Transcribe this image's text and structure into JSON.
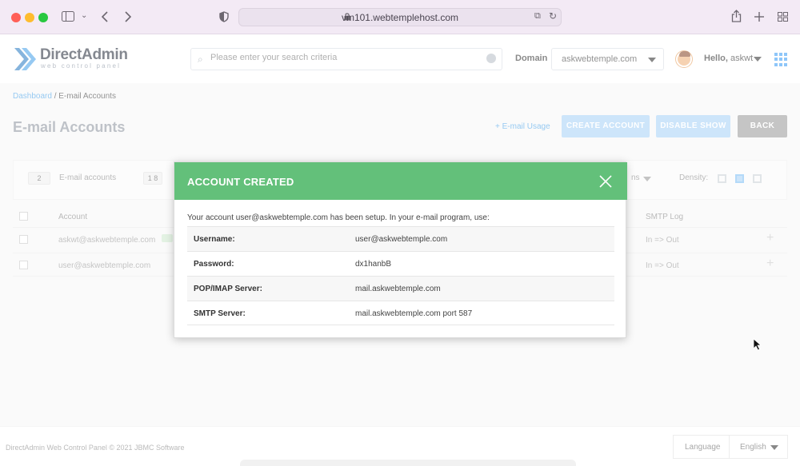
{
  "browser": {
    "url": "vm101.webtemplehost.com"
  },
  "header": {
    "logo_title": "DirectAdmin",
    "logo_subtitle": "web control panel",
    "search_placeholder": "Please enter your search criteria",
    "domain_label": "Domain",
    "domain_value": "askwebtemple.com",
    "hello_prefix": "Hello,",
    "username": "askwt"
  },
  "breadcrumb": {
    "home": "Dashboard",
    "separator": "/",
    "current": "E-mail Accounts"
  },
  "page": {
    "title": "E-mail Accounts",
    "usage_link": "+ E-mail Usage",
    "buttons": {
      "create": "CREATE ACCOUNT",
      "disable": "DISABLE SHOW",
      "back": "BACK"
    }
  },
  "summary": {
    "count_badge": "2",
    "count_label": "E-mail accounts",
    "second_badge": "1 8",
    "filter_label": "ns",
    "density_label": "Density:"
  },
  "table": {
    "headers": {
      "account": "Account",
      "smtp_log": "SMTP Log"
    },
    "rows": [
      {
        "account": "askwt@askwebtemple.com",
        "smtp": "In => Out"
      },
      {
        "account": "user@askwebtemple.com",
        "smtp": "In => Out"
      }
    ]
  },
  "footer": {
    "copyright": "DirectAdmin Web Control Panel © 2021 JBMC Software",
    "language_label": "Language",
    "language_value": "English"
  },
  "modal": {
    "title": "ACCOUNT CREATED",
    "intro": "Your account user@askwebtemple.com has been setup. In your e-mail program, use:",
    "rows": [
      {
        "label": "Username:",
        "value": "user@askwebtemple.com"
      },
      {
        "label": "Password:",
        "value": "dx1hanbB"
      },
      {
        "label": "POP/IMAP Server:",
        "value": "mail.askwebtemple.com"
      },
      {
        "label": "SMTP Server:",
        "value": "mail.askwebtemple.com port 587"
      }
    ],
    "header_color": "#63c07a"
  },
  "colors": {
    "accent": "#3d9ef5",
    "success": "#63c07a",
    "chrome": "#f3eaf5"
  },
  "icons": [
    "sidebar-icon",
    "back-arrow-icon",
    "forward-arrow-icon",
    "shield-icon",
    "lock-icon",
    "translate-icon",
    "reload-icon",
    "share-icon",
    "new-tab-icon",
    "tab-overview-icon",
    "search-icon",
    "grid-menu-icon",
    "close-icon",
    "cursor-icon"
  ]
}
